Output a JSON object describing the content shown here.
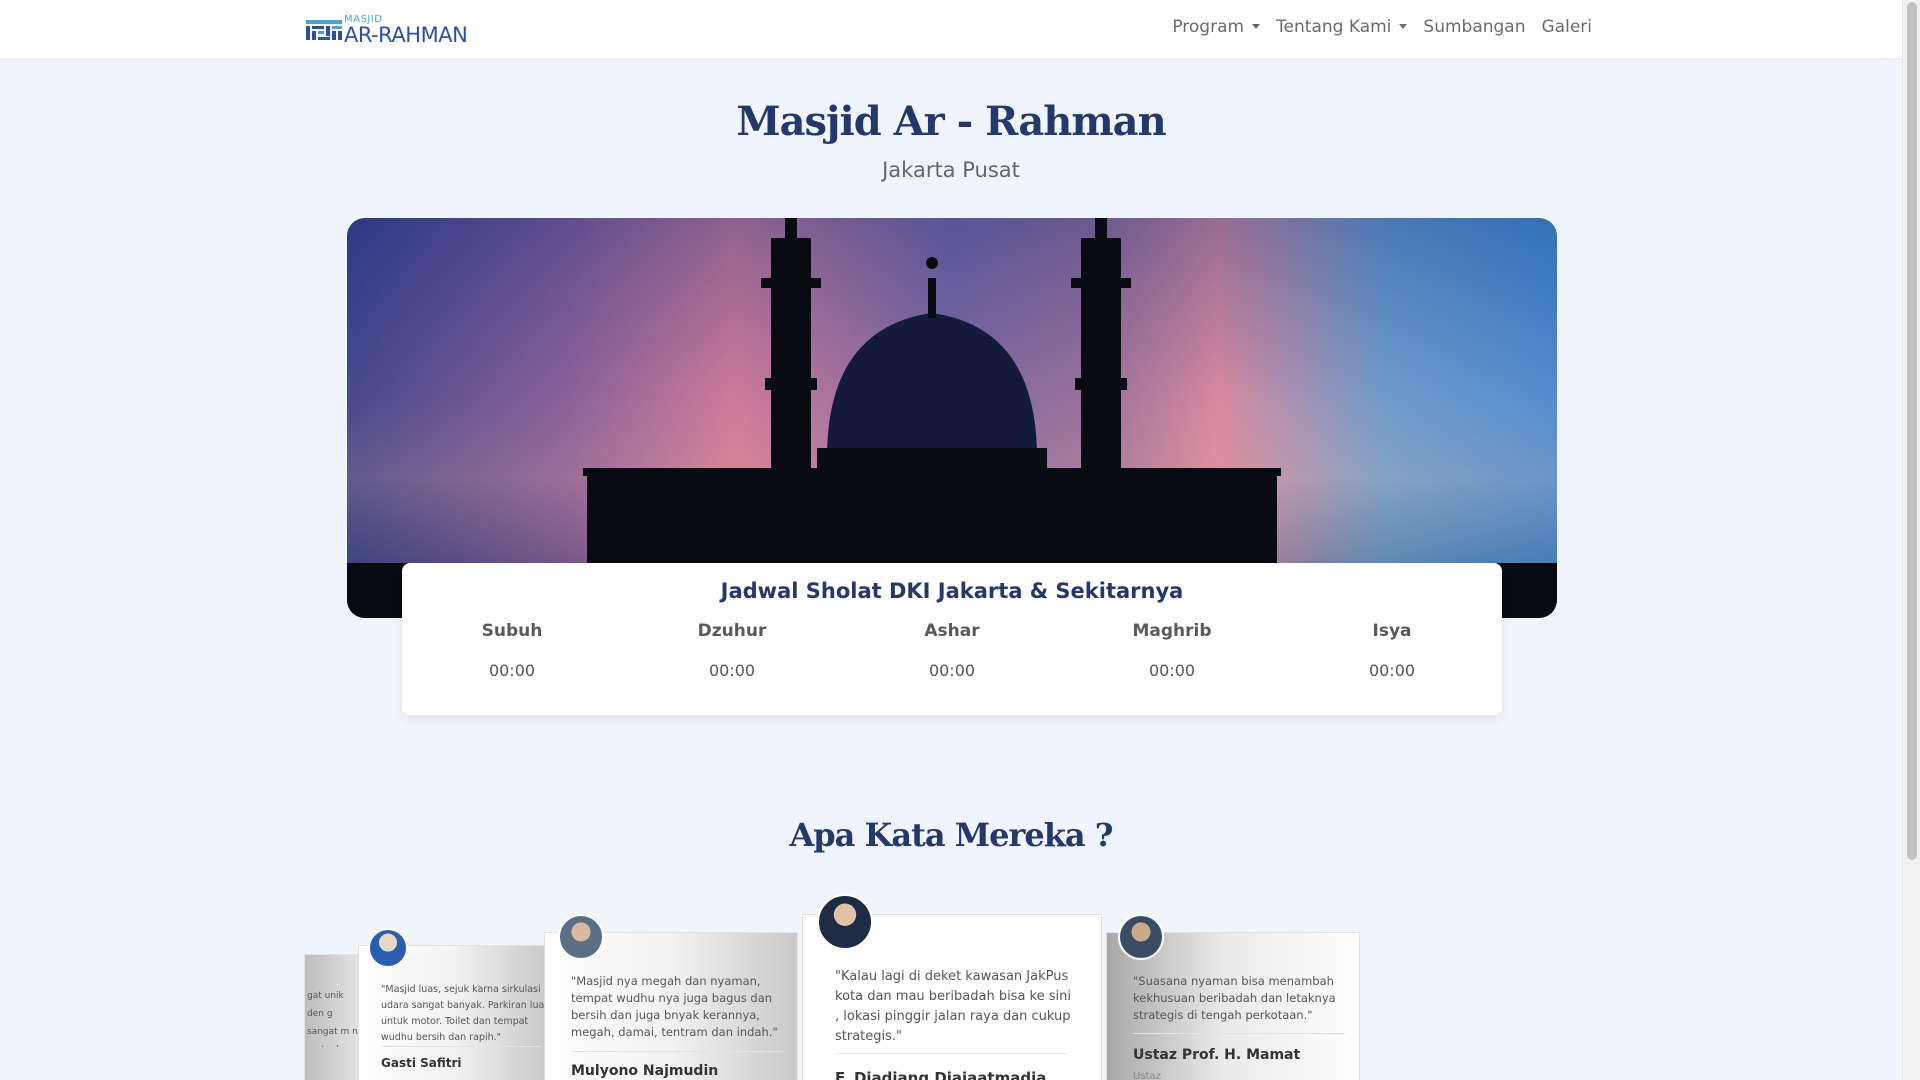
{
  "nav": {
    "logo_small": "MASJID",
    "logo_big": "AR-RAHMAN",
    "links": [
      {
        "label": "Program",
        "dropdown": true
      },
      {
        "label": "Tentang Kami",
        "dropdown": true
      },
      {
        "label": "Sumbangan",
        "dropdown": false
      },
      {
        "label": "Galeri",
        "dropdown": false
      }
    ]
  },
  "hero": {
    "title": "Masjid Ar - Rahman",
    "subtitle": "Jakarta Pusat"
  },
  "prayer": {
    "title": "Jadwal Sholat DKI Jakarta & Sekitarnya",
    "times": [
      {
        "name": "Subuh",
        "time": "00:00"
      },
      {
        "name": "Dzuhur",
        "time": "00:00"
      },
      {
        "name": "Ashar",
        "time": "00:00"
      },
      {
        "name": "Maghrib",
        "time": "00:00"
      },
      {
        "name": "Isya",
        "time": "00:00"
      }
    ]
  },
  "testimonials": {
    "title": "Apa Kata Mereka ?",
    "items": [
      {
        "quote": "gat unik den g sangat m n\" mata der yanya.\"",
        "name": "",
        "role": ""
      },
      {
        "quote": "\"Masjid luas, sejuk karna sirkulasi udara sangat banyak. Parkiran lua untuk motor. Toilet dan tempat wudhu bersih dan rapih.\"",
        "name": "Gasti Safitri",
        "role": ""
      },
      {
        "quote": "\"Masjid nya megah dan nyaman, tempat wudhu nya juga bagus dan bersih dan juga bnyak kerannya, megah, damai, tentram dan indah.\"",
        "name": "Mulyono Najmudin",
        "role": ""
      },
      {
        "quote": "\"Kalau lagi di deket kawasan JakPus kota dan mau beribadah bisa ke sini , lokasi pinggir jalan raya dan cukup strategis.\"",
        "name": "F. Djadjang Djajaatmadja",
        "role": ""
      },
      {
        "quote": "\"Suasana nyaman bisa menambah kekhusuan beribadah dan letaknya strategis di tengah perkotaan.\"",
        "name": "Ustaz Prof. H. Mamat",
        "role": "Ustaz"
      }
    ]
  }
}
